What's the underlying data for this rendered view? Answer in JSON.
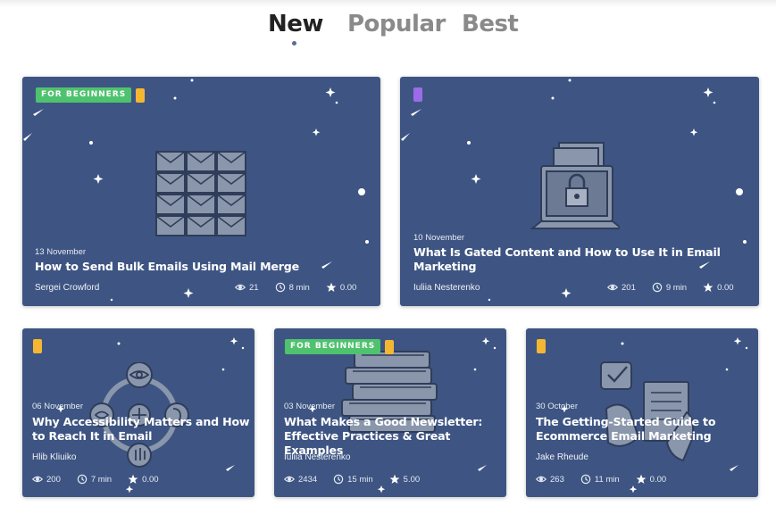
{
  "tabs": [
    {
      "label": "New",
      "active": true
    },
    {
      "label": "Popular",
      "active": false
    },
    {
      "label": "Best",
      "active": false
    }
  ],
  "colors": {
    "card_bg": "#3e5583",
    "badge_green": "#4fc26e",
    "chip_yellow": "#f5b731",
    "chip_purple": "#9c6ce8"
  },
  "cards": [
    {
      "badge": "FOR BEGINNERS",
      "chip_color": "yellow",
      "illustration": "envelope-puzzle-icon",
      "date": "13 November",
      "title": "How to Send Bulk Emails Using Mail Merge",
      "author": "Sergei Crowford",
      "views": "21",
      "read_time": "8 min",
      "rating": "0.00"
    },
    {
      "badge": "",
      "chip_color": "purple",
      "illustration": "laptop-lock-icon",
      "date": "10 November",
      "title": "What Is Gated Content and How to Use It in Email Marketing",
      "author": "Iuliia Nesterenko",
      "views": "201",
      "read_time": "9 min",
      "rating": "0.00"
    },
    {
      "badge": "",
      "chip_color": "yellow",
      "illustration": "accessibility-icons",
      "date": "06 November",
      "title": "Why Accessibility Matters and How to Reach It in Email",
      "author": "Hlib Kliuiko",
      "views": "200",
      "read_time": "7 min",
      "rating": "0.00"
    },
    {
      "badge": "FOR BEGINNERS",
      "chip_color": "yellow",
      "illustration": "book-stack-icon",
      "date": "03 November",
      "title": "What Makes a Good Newsletter: Effective Practices & Great Examples",
      "author": "Iuliia Nesterenko",
      "views": "2434",
      "read_time": "15 min",
      "rating": "5.00"
    },
    {
      "badge": "",
      "chip_color": "yellow",
      "illustration": "checklist-hands-icon",
      "date": "30 October",
      "title": "The Getting-Started Guide to Ecommerce Email Marketing",
      "author": "Jake Rheude",
      "views": "263",
      "read_time": "11 min",
      "rating": "0.00"
    }
  ]
}
